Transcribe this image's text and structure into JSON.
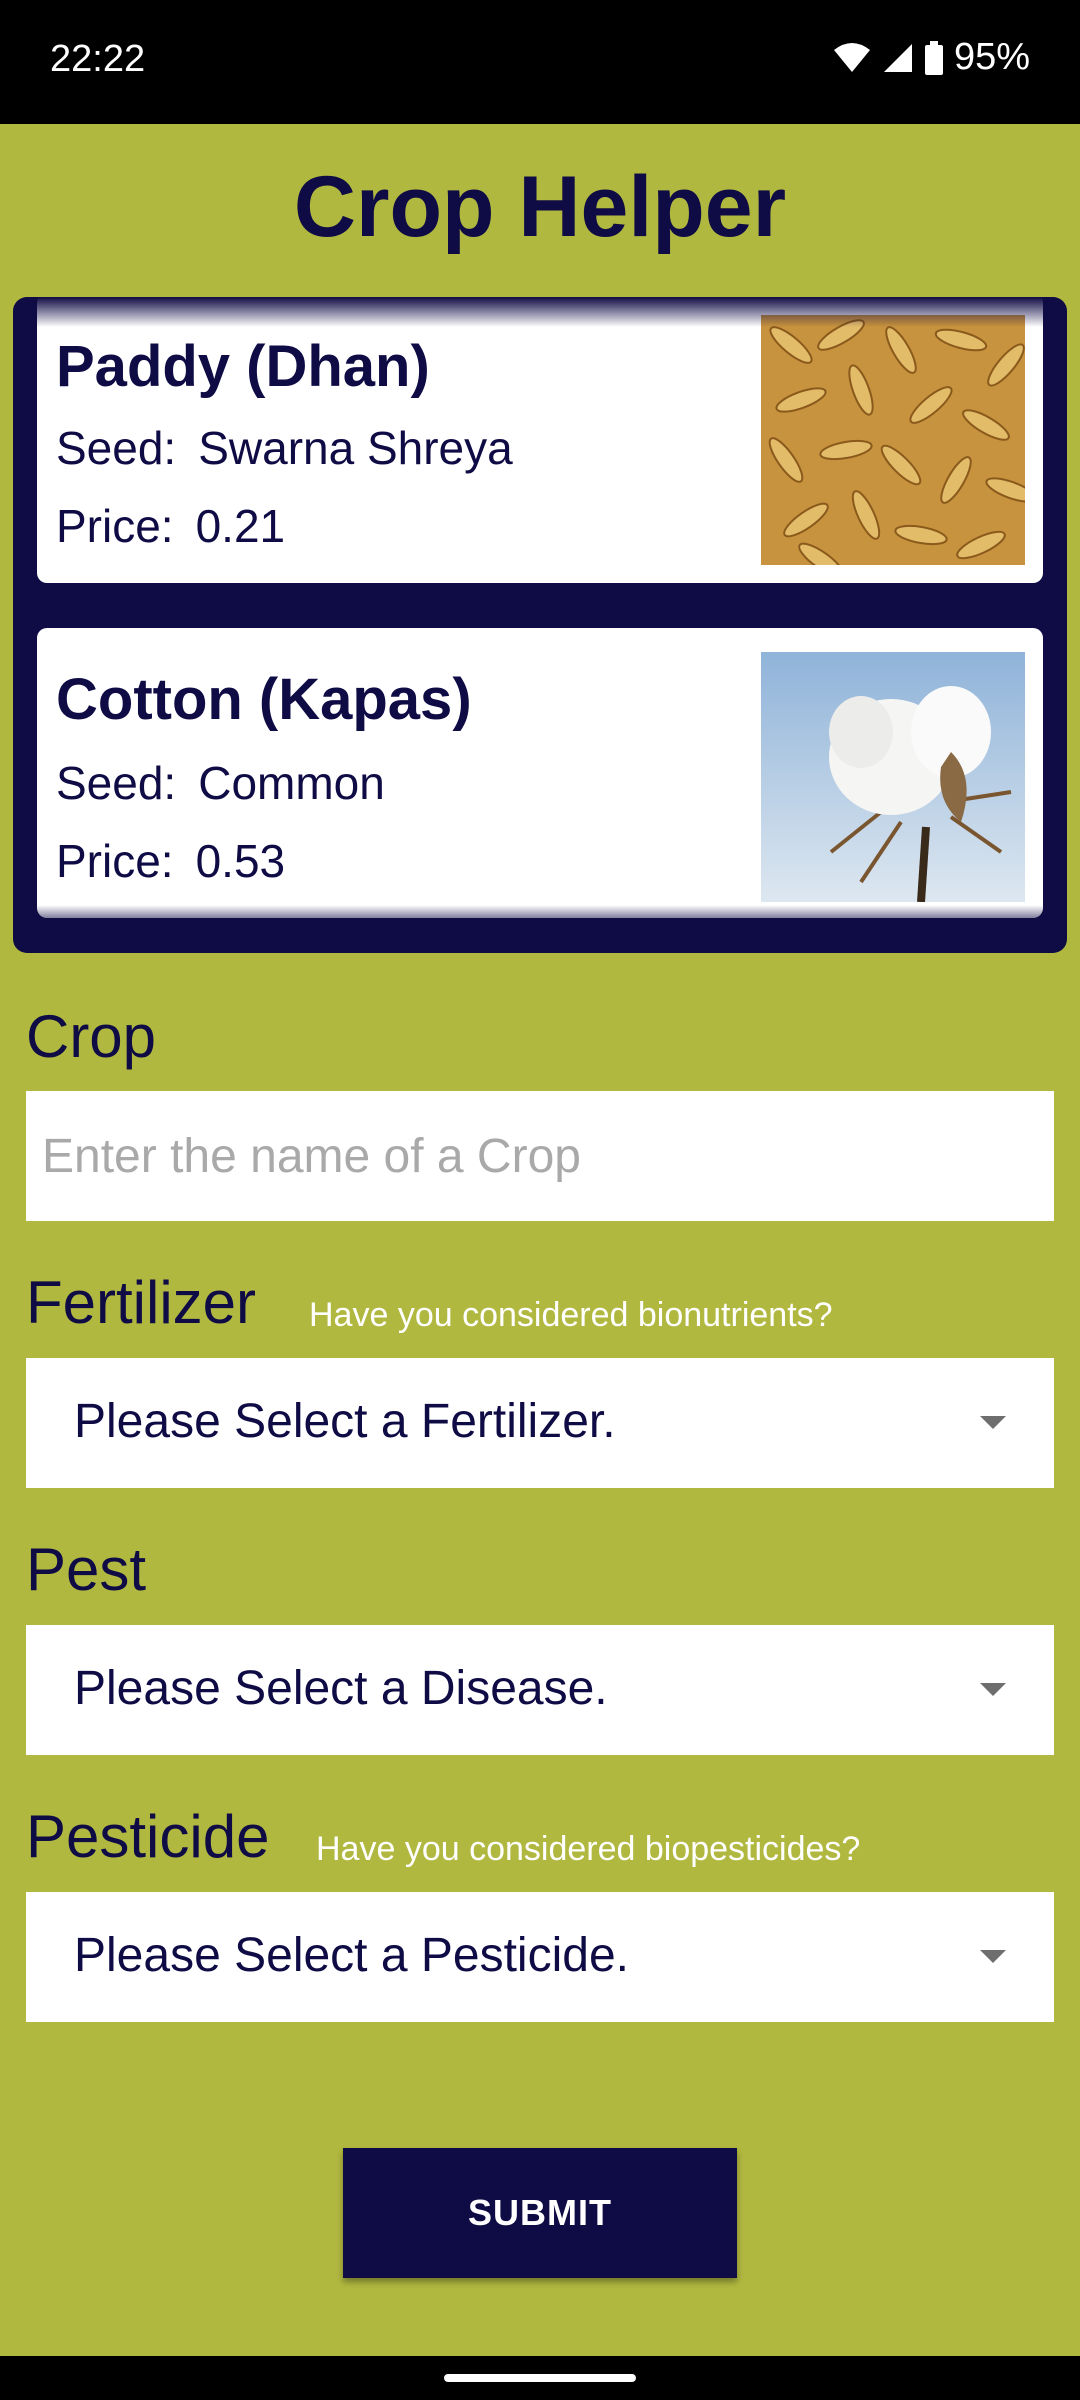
{
  "status_bar": {
    "time": "22:22",
    "battery": "95%"
  },
  "app": {
    "title": "Crop Helper"
  },
  "crops": [
    {
      "name": "Paddy (Dhan)",
      "seed_label": "Seed:",
      "seed": "Swarna Shreya",
      "price_label": "Price:",
      "price": "0.21",
      "image": "paddy-grains-image"
    },
    {
      "name": "Cotton (Kapas)",
      "seed_label": "Seed:",
      "seed": "Common",
      "price_label": "Price:",
      "price": "0.53",
      "image": "cotton-boll-image"
    }
  ],
  "form": {
    "crop": {
      "label": "Crop",
      "placeholder": "Enter the name of a Crop",
      "value": ""
    },
    "fertilizer": {
      "label": "Fertilizer",
      "hint": "Have you considered bionutrients?",
      "selected": "Please Select a Fertilizer."
    },
    "pest": {
      "label": "Pest",
      "selected": "Please Select a Disease."
    },
    "pesticide": {
      "label": "Pesticide",
      "hint": "Have you considered biopesticides?",
      "selected": "Please Select a Pesticide."
    },
    "submit_label": "SUBMIT"
  },
  "colors": {
    "background": "#b1b840",
    "primary": "#0f0b45",
    "card": "#ffffff"
  }
}
